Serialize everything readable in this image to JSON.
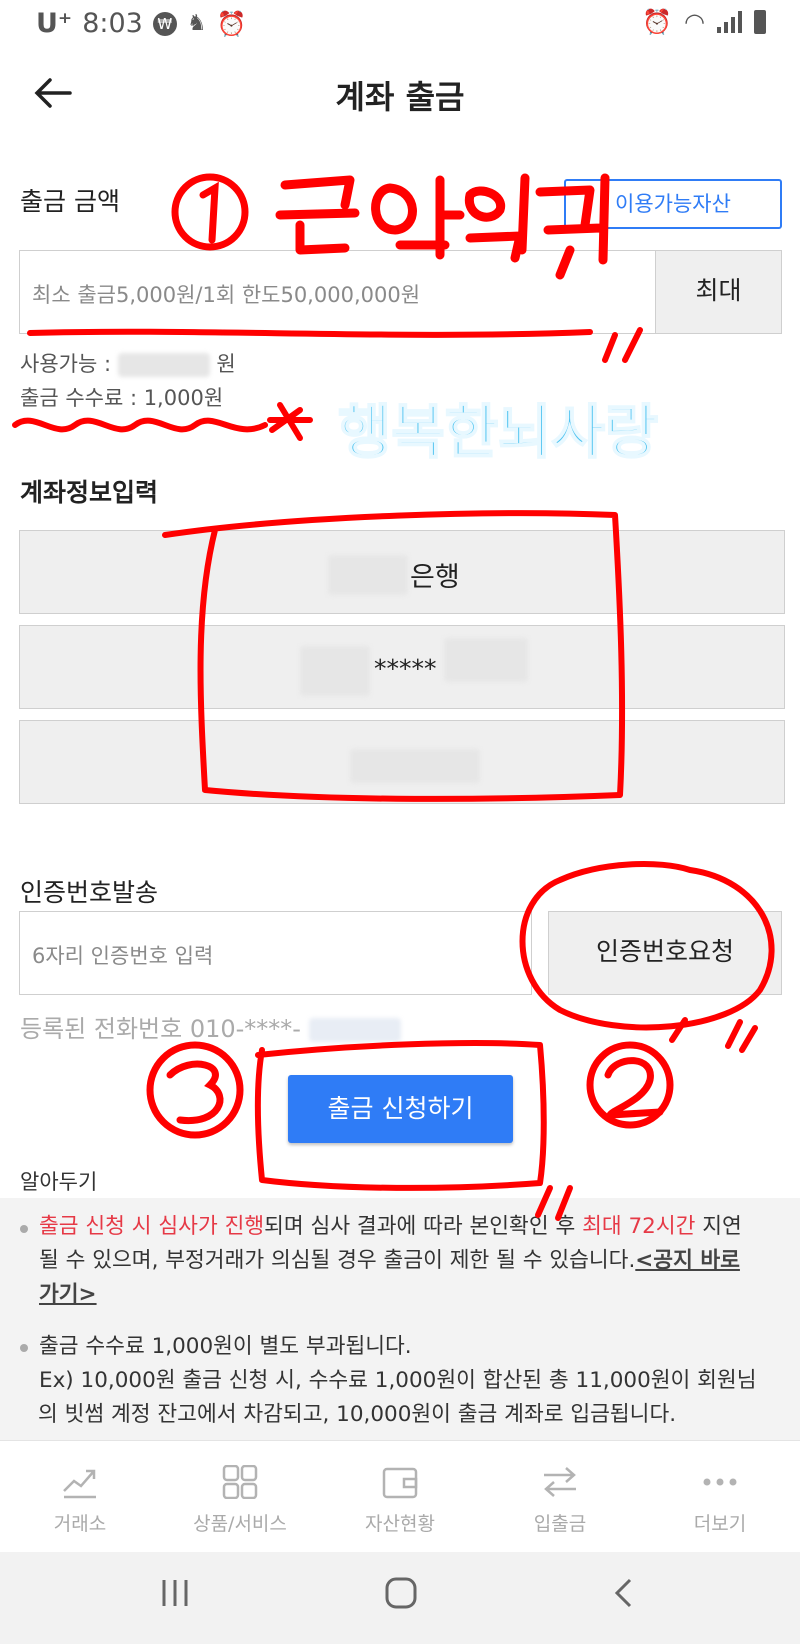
{
  "status_bar": {
    "carrier": "U⁺",
    "time": "8:03"
  },
  "header": {
    "title": "계좌 출금"
  },
  "amount": {
    "label": "출금 금액",
    "available_assets_button": "이용가능자산",
    "input_placeholder": "최소 출금5,000원/1회 한도50,000,000원",
    "max_button": "최대",
    "available_prefix": "사용가능 :",
    "available_unit": "원",
    "fee_text": "출금 수수료 : 1,000원"
  },
  "account": {
    "label": "계좌정보입력",
    "bank_suffix": "은행",
    "account_masked": "*****"
  },
  "verify": {
    "label": "인증번호발송",
    "input_placeholder": "6자리 인증번호 입력",
    "request_button": "인증번호요청",
    "registered_phone": "등록된 전화번호 010-****-"
  },
  "submit_button": "출금 신청하기",
  "notice": {
    "title": "알아두기",
    "item1_red1": "출금 신청 시 심사가 진행",
    "item1_mid": "되며 심사 결과에 따라 본인확인 후 ",
    "item1_red2": "최대 72시간",
    "item1_end": " 지연",
    "item1_line2": "될 수 있으며, 부정거래가 의심될 경우 출금이 제한 될 수 있습니다.",
    "item1_link_a": "<공지 바로",
    "item1_link_b": "가기>",
    "item2_line1": "출금 수수료 1,000원이 별도 부과됩니다.",
    "item2_line2": "Ex) 10,000원 출금 신청 시, 수수료 1,000원이 합산된 총 11,000원이 회원님",
    "item2_line3": "의 빗썸 계정 잔고에서 차감되고, 10,000원이 출금 계좌로 입금됩니다."
  },
  "annotations": {
    "step1": "① 금액입력",
    "step2": "②",
    "step3": "③",
    "watermark": "행복한뇌사랑"
  },
  "tabs": [
    {
      "label": "거래소",
      "icon": "chart-line-icon"
    },
    {
      "label": "상품/서비스",
      "icon": "grid-icon"
    },
    {
      "label": "자산현황",
      "icon": "wallet-icon"
    },
    {
      "label": "입출금",
      "icon": "transfer-arrows-icon"
    },
    {
      "label": "더보기",
      "icon": "more-dots-icon"
    }
  ],
  "colors": {
    "primary_blue": "#2f7cf6",
    "accent_red": "#e63946",
    "annotation_red": "#ff0000",
    "watermark_cyan": "#4ec3f0"
  }
}
